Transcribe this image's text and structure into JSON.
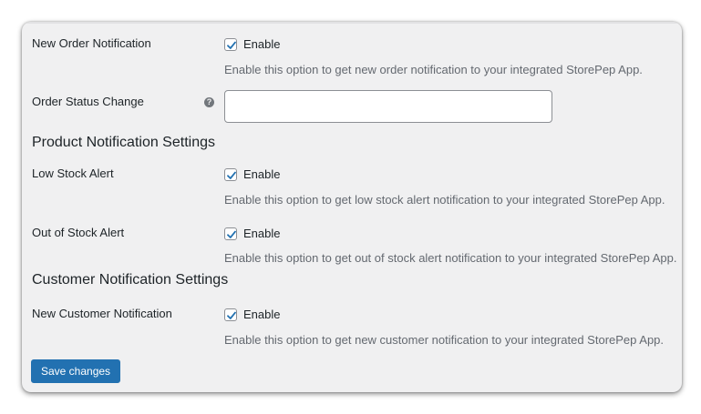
{
  "order_settings": {
    "new_order": {
      "label": "New Order Notification",
      "checked": true,
      "check_label": "Enable",
      "description": "Enable this option to get new order notification to your integrated StorePep App."
    },
    "order_status_change": {
      "label": "Order Status Change",
      "help_icon": "help-icon",
      "value": ""
    }
  },
  "product_section": {
    "heading": "Product Notification Settings",
    "low_stock": {
      "label": "Low Stock Alert",
      "checked": true,
      "check_label": "Enable",
      "description": "Enable this option to get low stock alert notification to your integrated StorePep App."
    },
    "out_of_stock": {
      "label": "Out of Stock Alert",
      "checked": true,
      "check_label": "Enable",
      "description": "Enable this option to get out of stock alert notification to your integrated StorePep App."
    }
  },
  "customer_section": {
    "heading": "Customer Notification Settings",
    "new_customer": {
      "label": "New Customer Notification",
      "checked": true,
      "check_label": "Enable",
      "description": "Enable this option to get new customer notification to your integrated StorePep App."
    }
  },
  "actions": {
    "save_label": "Save changes"
  },
  "colors": {
    "accent": "#2271b1",
    "panel_bg": "#f0f0f1",
    "description_text": "#646970"
  }
}
